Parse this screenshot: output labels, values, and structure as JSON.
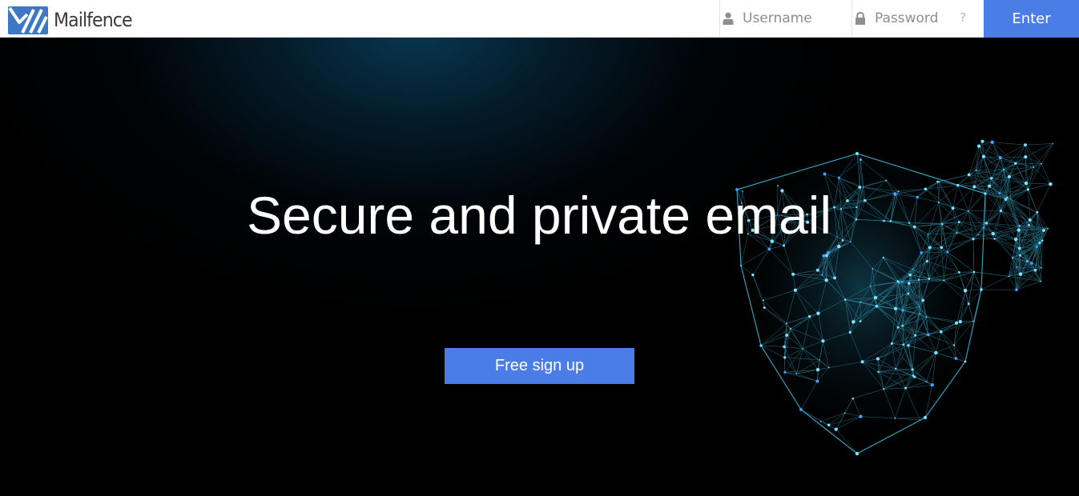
{
  "header": {
    "logo_text": "Mailfence",
    "username_placeholder": "Username",
    "password_placeholder": "Password",
    "help_label": "?",
    "enter_label": "Enter"
  },
  "hero": {
    "headline": "Secure and private email",
    "signup_label": "Free sign up"
  },
  "icons": {
    "logo": "mailfence-logo-icon",
    "username": "user-icon",
    "password": "lock-icon",
    "hero_graphic": "network-shield-icon"
  },
  "colors": {
    "accent": "#4a7ee6",
    "logo_blue": "#3e78c5",
    "background": "#000000",
    "glow": "#083a56",
    "network": "#3fc3e8"
  }
}
